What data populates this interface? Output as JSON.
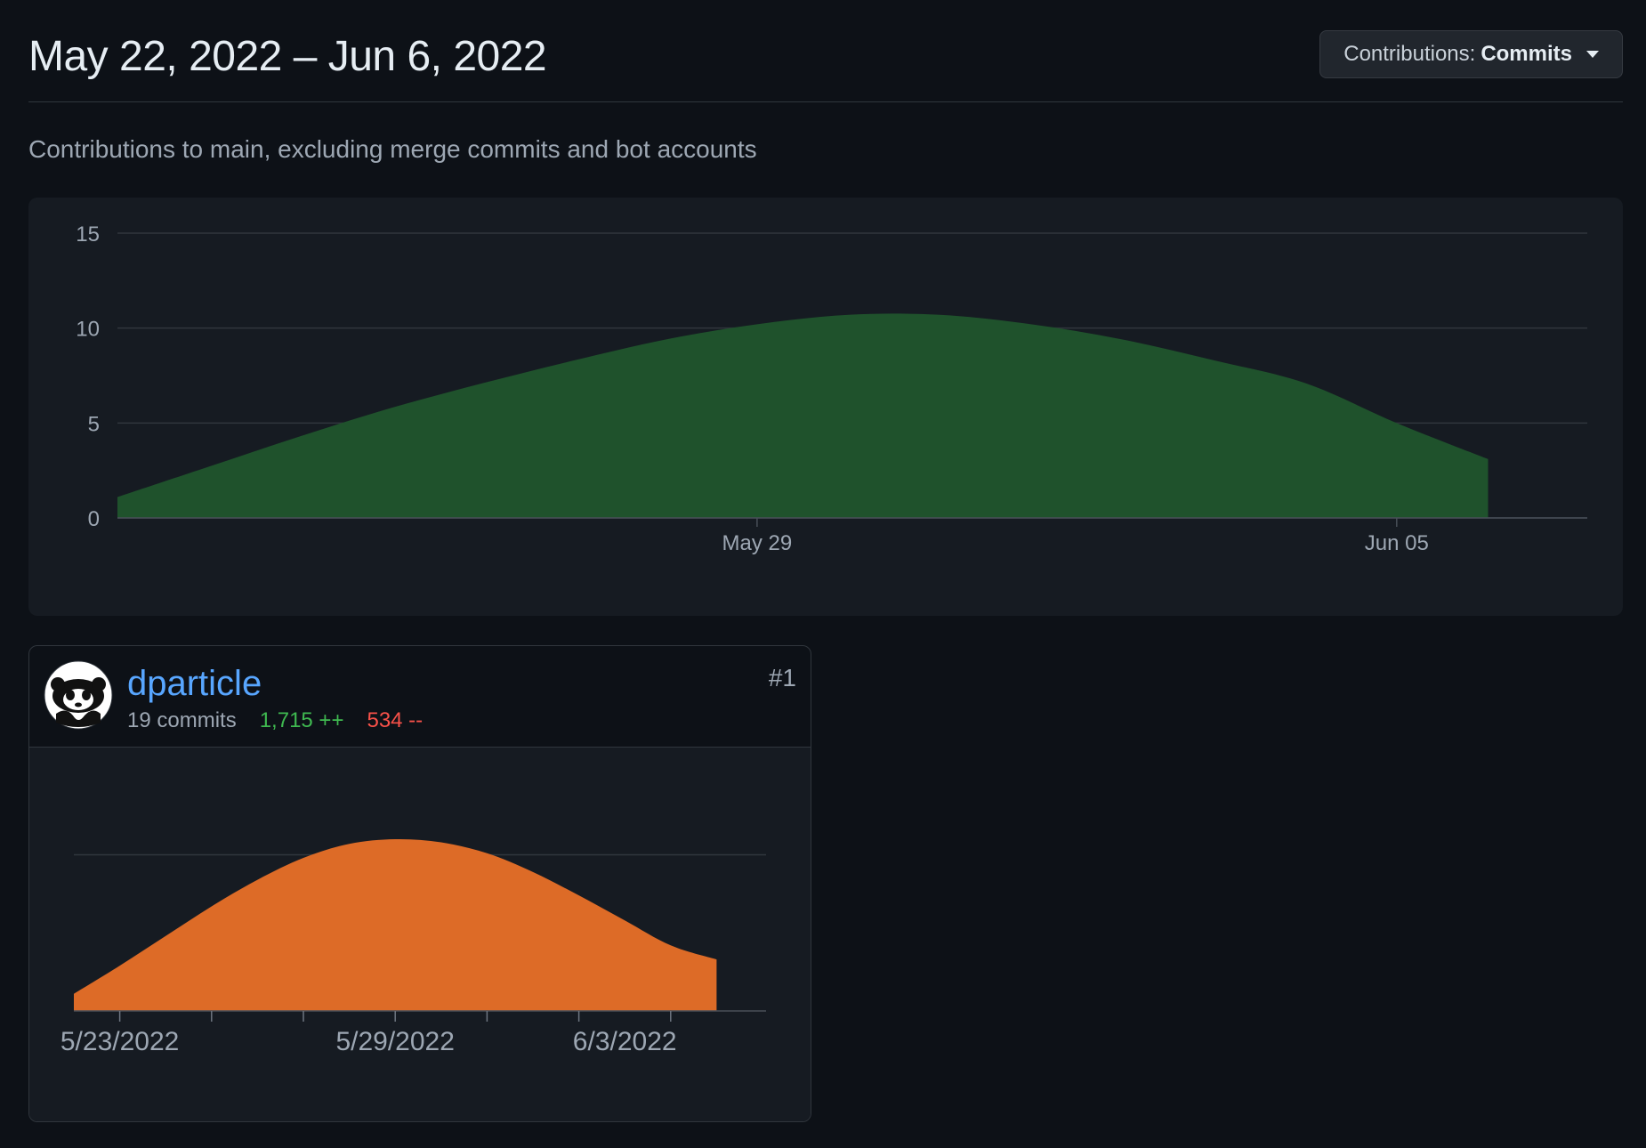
{
  "header": {
    "date_range": "May 22, 2022 – Jun 6, 2022",
    "contributions_prefix": "Contributions:",
    "contributions_value": "Commits"
  },
  "subtitle": "Contributions to main, excluding merge commits and bot accounts",
  "colors": {
    "main_area": "#1f522c",
    "contributor_area": "#dd6b27",
    "additions": "#3fb950",
    "deletions": "#f85149",
    "link": "#58a6ff"
  },
  "chart_data": [
    {
      "type": "area",
      "x": [
        "2022-05-22",
        "2022-05-23",
        "2022-05-24",
        "2022-05-25",
        "2022-05-26",
        "2022-05-27",
        "2022-05-28",
        "2022-05-29",
        "2022-05-30",
        "2022-05-31",
        "2022-06-01",
        "2022-06-02",
        "2022-06-03",
        "2022-06-04",
        "2022-06-05",
        "2022-06-06"
      ],
      "values": [
        1.1,
        2.7,
        4.3,
        5.8,
        7.1,
        8.3,
        9.4,
        10.2,
        10.7,
        10.7,
        10.2,
        9.4,
        8.3,
        7.1,
        5.0,
        3.1
      ],
      "ylim": [
        0,
        15
      ],
      "yticks": [
        "0",
        "5",
        "10",
        "15"
      ],
      "xticks": [
        {
          "label": "May 29",
          "x": "2022-05-29"
        },
        {
          "label": "Jun 05",
          "x": "2022-06-05"
        }
      ],
      "grid": true
    },
    {
      "type": "area",
      "x": [
        "2022-05-22",
        "2022-05-23",
        "2022-05-24",
        "2022-05-25",
        "2022-05-26",
        "2022-05-27",
        "2022-05-28",
        "2022-05-29",
        "2022-05-30",
        "2022-05-31",
        "2022-06-01",
        "2022-06-02",
        "2022-06-03",
        "2022-06-04",
        "2022-06-05"
      ],
      "values": [
        1.1,
        2.9,
        4.8,
        6.7,
        8.4,
        9.8,
        10.7,
        11.0,
        10.8,
        10.1,
        8.9,
        7.4,
        5.8,
        4.2,
        3.3
      ],
      "ylim": [
        0,
        11
      ],
      "xticks": [
        {
          "label": "5/23/2022",
          "x": "2022-05-23"
        },
        {
          "label": "5/29/2022",
          "x": "2022-05-29"
        },
        {
          "label": "6/3/2022",
          "x": "2022-06-03"
        }
      ],
      "grid": true
    }
  ],
  "contributor": {
    "username": "dparticle",
    "commits": "19 commits",
    "additions": "1,715 ++",
    "deletions": "534 --",
    "rank": "#1",
    "avatar_icon": "panda-avatar-icon"
  }
}
